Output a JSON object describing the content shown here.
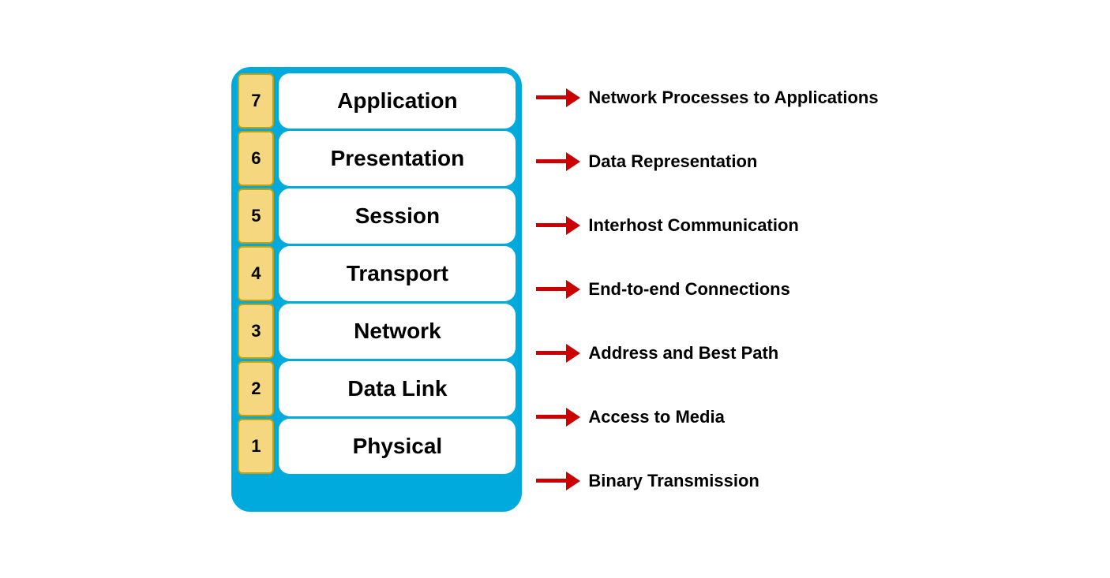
{
  "layers": [
    {
      "number": "7",
      "name": "Application",
      "description": "Network Processes to Applications"
    },
    {
      "number": "6",
      "name": "Presentation",
      "description": "Data Representation"
    },
    {
      "number": "5",
      "name": "Session",
      "description": "Interhost Communication"
    },
    {
      "number": "4",
      "name": "Transport",
      "description": "End-to-end Connections"
    },
    {
      "number": "3",
      "name": "Network",
      "description": "Address and Best Path"
    },
    {
      "number": "2",
      "name": "Data Link",
      "description": "Access to Media"
    },
    {
      "number": "1",
      "name": "Physical",
      "description": "Binary Transmission"
    }
  ]
}
